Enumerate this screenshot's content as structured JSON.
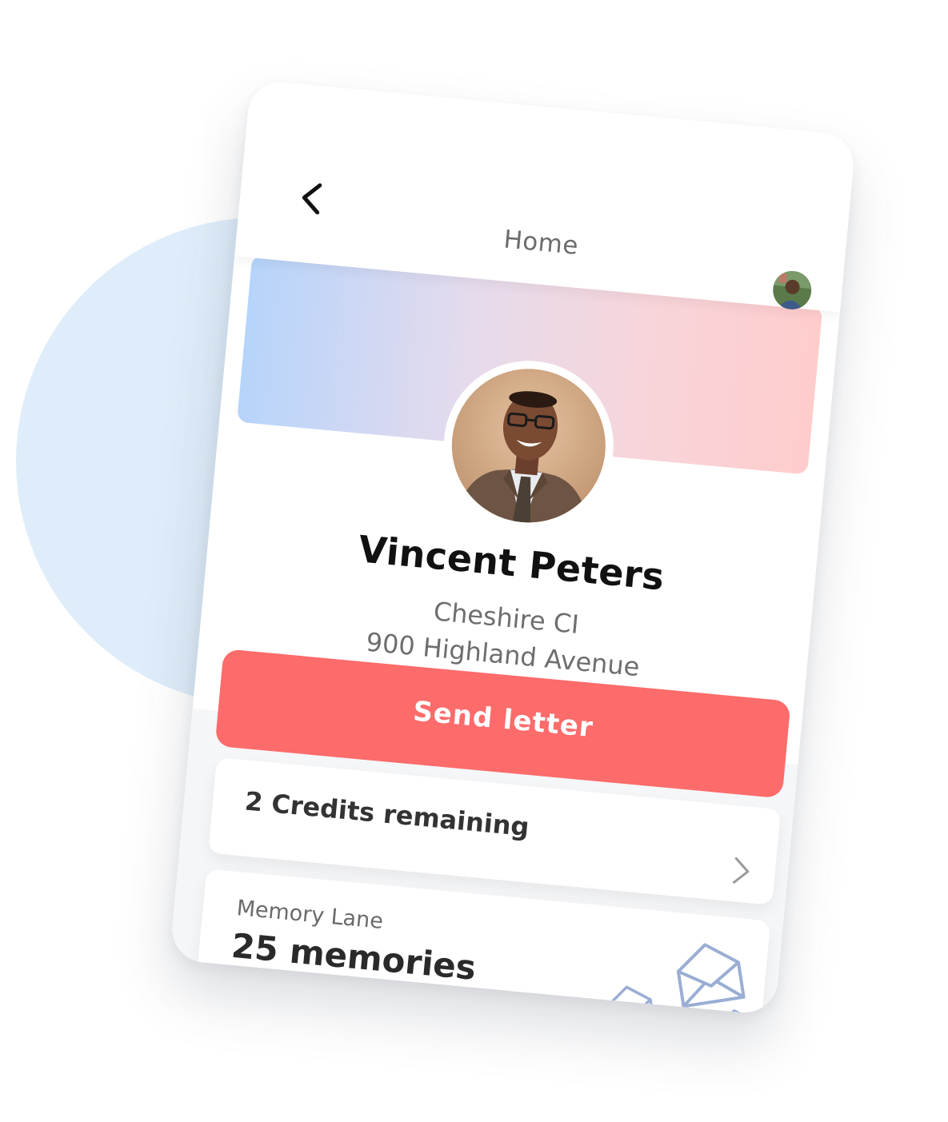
{
  "header": {
    "title": "Home",
    "back_icon": "chevron-left-icon",
    "avatar": "user-avatar"
  },
  "profile": {
    "name": "Vincent Peters",
    "address_line1": "Cheshire CI",
    "address_line2": "900 Highland Avenue",
    "cover_gradient": [
      "#b6d4fb",
      "#e6dbec",
      "#ffcccc"
    ]
  },
  "actions": {
    "send_letter_label": "Send letter",
    "send_letter_color": "#fd6b6b"
  },
  "credits": {
    "label": "2 Credits remaining",
    "icon": "chevron-right-icon"
  },
  "memory_lane": {
    "label": "Memory Lane",
    "count": "25 memories",
    "icon": "envelope-icon",
    "icon_color": "#9aaed4"
  }
}
